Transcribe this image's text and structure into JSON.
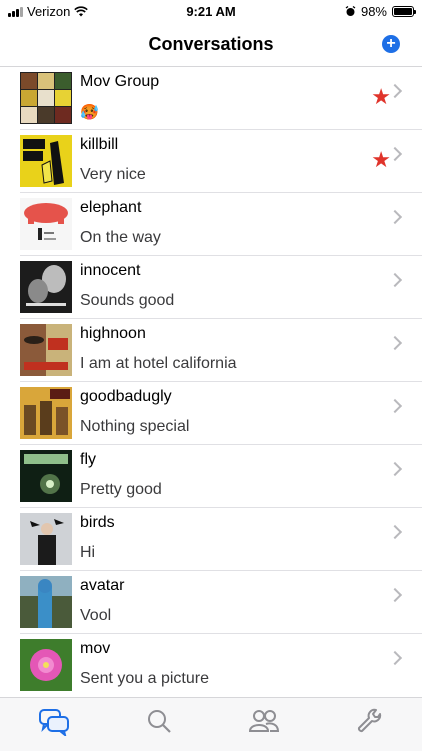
{
  "status_bar": {
    "carrier": "Verizon",
    "time": "9:21 AM",
    "battery_pct": "98%",
    "battery_level": 0.98
  },
  "nav": {
    "title": "Conversations",
    "add_icon": "plus-circle-icon",
    "accent": "#1e6fe6"
  },
  "conversations": [
    {
      "name": "Mov Group",
      "message": "🥵",
      "starred": true
    },
    {
      "name": "killbill",
      "message": "Very nice",
      "starred": true
    },
    {
      "name": "elephant",
      "message": "On the way",
      "starred": false
    },
    {
      "name": "innocent",
      "message": "Sounds good",
      "starred": false
    },
    {
      "name": "highnoon",
      "message": "I am at hotel california",
      "starred": false
    },
    {
      "name": "goodbadugly",
      "message": "Nothing special",
      "starred": false
    },
    {
      "name": "fly",
      "message": "Pretty good",
      "starred": false
    },
    {
      "name": "birds",
      "message": "Hi",
      "starred": false
    },
    {
      "name": "avatar",
      "message": "Vool",
      "starred": false
    },
    {
      "name": "mov",
      "message": "Sent you a picture",
      "starred": false
    }
  ],
  "tabs": [
    {
      "icon": "chat-bubbles-icon",
      "active": true
    },
    {
      "icon": "search-icon",
      "active": false
    },
    {
      "icon": "contacts-icon",
      "active": false
    },
    {
      "icon": "wrench-icon",
      "active": false
    }
  ],
  "colors": {
    "star": "#e0342b",
    "active_tab": "#1e6fe6",
    "inactive_tab": "#8e8e93"
  }
}
